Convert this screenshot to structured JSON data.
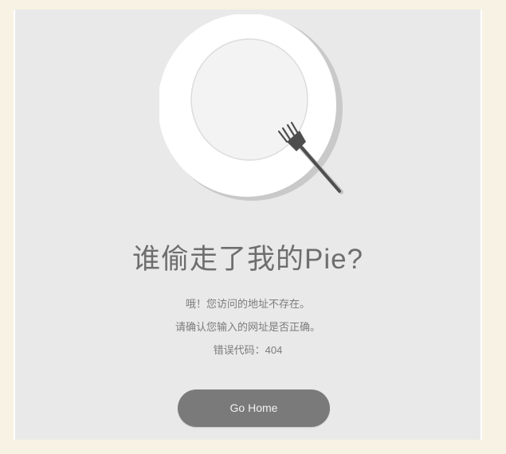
{
  "page": {
    "background_color": "#f7f2e3",
    "panel_color": "#e9e9e9"
  },
  "illustration": {
    "plate_icon": "plate-icon",
    "fork_icon": "fork-icon"
  },
  "error": {
    "title": "谁偷走了我的Pie?",
    "line1": "哦！您访问的地址不存在。",
    "line2": "请确认您输入的网址是否正确。",
    "line3": "错误代码：404"
  },
  "actions": {
    "home_button_label": "Go Home",
    "home_button_color": "#7a7a7a"
  }
}
